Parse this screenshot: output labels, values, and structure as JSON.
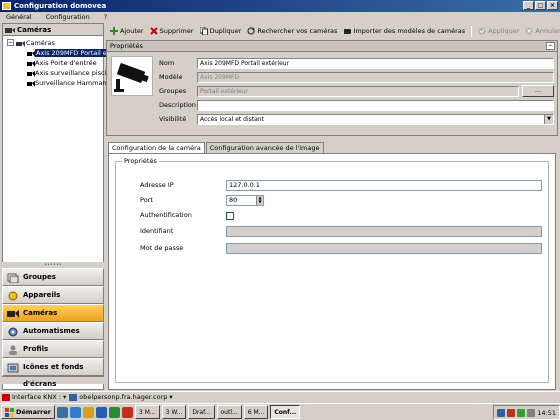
{
  "window": {
    "title": "Configuration domovea",
    "btn_min": "_",
    "btn_max": "□",
    "btn_close": "×"
  },
  "menu": [
    "Général",
    "Configuration",
    "?"
  ],
  "left_panel": {
    "header": "Caméras",
    "tree_root": "Caméras",
    "tree_items": [
      "Axis 209MFD Portail extérieur",
      "Axis Porte d'entrée",
      "Axis surveillance piscine",
      "Surveillance Hammam"
    ],
    "splitter_grip": "••••••",
    "nav_buttons": [
      {
        "label": "Groupes",
        "icon": "groups-icon"
      },
      {
        "label": "Appareils",
        "icon": "devices-icon"
      },
      {
        "label": "Caméras",
        "icon": "camera-icon"
      },
      {
        "label": "Automatismes",
        "icon": "automation-icon"
      },
      {
        "label": "Profils",
        "icon": "profiles-icon"
      },
      {
        "label": "Icônes et fonds d'écrans",
        "icon": "wallpapers-icon"
      }
    ]
  },
  "toolbar": {
    "add": "Ajouter",
    "delete": "Supprimer",
    "duplicate": "Dupliquer",
    "search": "Rechercher vos caméras",
    "import": "Importer des modèles de caméras",
    "apply": "Appliquer",
    "cancel": "Annuler"
  },
  "properties": {
    "header": "Propriétés",
    "collapse": "−",
    "name_label": "Nom",
    "name_value": "Axis 209MFD Portail extérieur",
    "model_label": "Modèle",
    "model_value": "Axis 209MFD",
    "groups_label": "Groupes",
    "groups_value": "Portail extérieur",
    "groups_button": "...",
    "description_label": "Description",
    "description_value": "",
    "visibility_label": "Visibilité",
    "visibility_value": "Accès local et distant"
  },
  "tabs": [
    "Configuration de la caméra",
    "Configuration avancée de l'image"
  ],
  "camera_config": {
    "group_title": "Propriétés",
    "ip_label": "Adresse IP",
    "ip_value": "127.0.0.1",
    "port_label": "Port",
    "port_value": "80",
    "auth_label": "Authentification",
    "auth_checked": false,
    "id_label": "Identifiant",
    "id_value": "",
    "pwd_label": "Mot de passe",
    "pwd_value": ""
  },
  "statusbar": {
    "item1": "Interface KNX :",
    "item1_arrow": "▾",
    "item2": "obelpersonp.fra.hager.corp",
    "item2_arrow": "▾"
  },
  "taskbar": {
    "start": "Démarrer",
    "buttons": [
      "3 M...",
      "3 W...",
      "Draf...",
      "outl...",
      "6 M...",
      "Conf..."
    ],
    "active_index": 5,
    "clock": "14:51"
  },
  "colors": {
    "titlebar": "#0a246a",
    "selection": "#0a246a",
    "active_nav": "#f0a020"
  }
}
